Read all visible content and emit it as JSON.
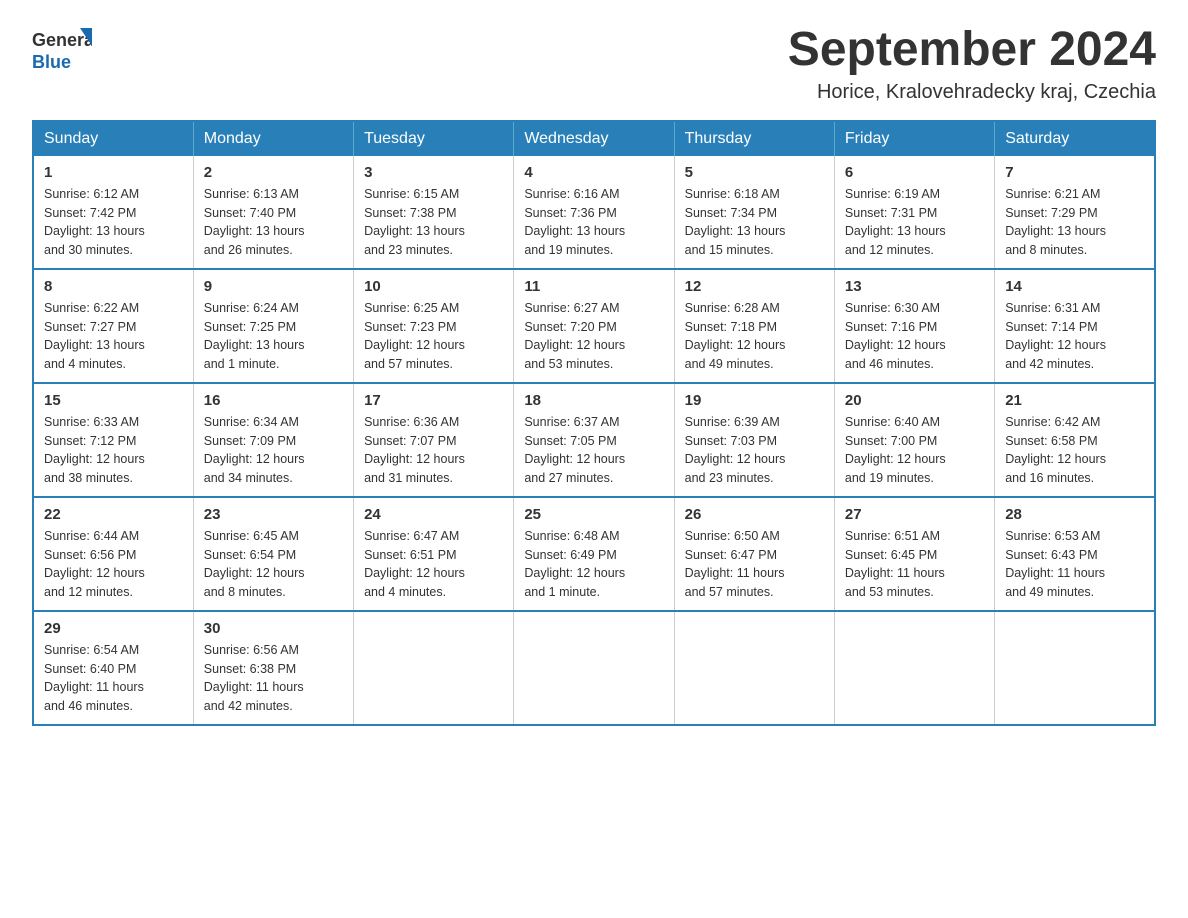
{
  "header": {
    "logo_general": "General",
    "logo_blue": "Blue",
    "month_title": "September 2024",
    "location": "Horice, Kralovehradecky kraj, Czechia"
  },
  "weekdays": [
    "Sunday",
    "Monday",
    "Tuesday",
    "Wednesday",
    "Thursday",
    "Friday",
    "Saturday"
  ],
  "weeks": [
    [
      {
        "day": "1",
        "sunrise": "6:12 AM",
        "sunset": "7:42 PM",
        "daylight": "13 hours and 30 minutes."
      },
      {
        "day": "2",
        "sunrise": "6:13 AM",
        "sunset": "7:40 PM",
        "daylight": "13 hours and 26 minutes."
      },
      {
        "day": "3",
        "sunrise": "6:15 AM",
        "sunset": "7:38 PM",
        "daylight": "13 hours and 23 minutes."
      },
      {
        "day": "4",
        "sunrise": "6:16 AM",
        "sunset": "7:36 PM",
        "daylight": "13 hours and 19 minutes."
      },
      {
        "day": "5",
        "sunrise": "6:18 AM",
        "sunset": "7:34 PM",
        "daylight": "13 hours and 15 minutes."
      },
      {
        "day": "6",
        "sunrise": "6:19 AM",
        "sunset": "7:31 PM",
        "daylight": "13 hours and 12 minutes."
      },
      {
        "day": "7",
        "sunrise": "6:21 AM",
        "sunset": "7:29 PM",
        "daylight": "13 hours and 8 minutes."
      }
    ],
    [
      {
        "day": "8",
        "sunrise": "6:22 AM",
        "sunset": "7:27 PM",
        "daylight": "13 hours and 4 minutes."
      },
      {
        "day": "9",
        "sunrise": "6:24 AM",
        "sunset": "7:25 PM",
        "daylight": "13 hours and 1 minute."
      },
      {
        "day": "10",
        "sunrise": "6:25 AM",
        "sunset": "7:23 PM",
        "daylight": "12 hours and 57 minutes."
      },
      {
        "day": "11",
        "sunrise": "6:27 AM",
        "sunset": "7:20 PM",
        "daylight": "12 hours and 53 minutes."
      },
      {
        "day": "12",
        "sunrise": "6:28 AM",
        "sunset": "7:18 PM",
        "daylight": "12 hours and 49 minutes."
      },
      {
        "day": "13",
        "sunrise": "6:30 AM",
        "sunset": "7:16 PM",
        "daylight": "12 hours and 46 minutes."
      },
      {
        "day": "14",
        "sunrise": "6:31 AM",
        "sunset": "7:14 PM",
        "daylight": "12 hours and 42 minutes."
      }
    ],
    [
      {
        "day": "15",
        "sunrise": "6:33 AM",
        "sunset": "7:12 PM",
        "daylight": "12 hours and 38 minutes."
      },
      {
        "day": "16",
        "sunrise": "6:34 AM",
        "sunset": "7:09 PM",
        "daylight": "12 hours and 34 minutes."
      },
      {
        "day": "17",
        "sunrise": "6:36 AM",
        "sunset": "7:07 PM",
        "daylight": "12 hours and 31 minutes."
      },
      {
        "day": "18",
        "sunrise": "6:37 AM",
        "sunset": "7:05 PM",
        "daylight": "12 hours and 27 minutes."
      },
      {
        "day": "19",
        "sunrise": "6:39 AM",
        "sunset": "7:03 PM",
        "daylight": "12 hours and 23 minutes."
      },
      {
        "day": "20",
        "sunrise": "6:40 AM",
        "sunset": "7:00 PM",
        "daylight": "12 hours and 19 minutes."
      },
      {
        "day": "21",
        "sunrise": "6:42 AM",
        "sunset": "6:58 PM",
        "daylight": "12 hours and 16 minutes."
      }
    ],
    [
      {
        "day": "22",
        "sunrise": "6:44 AM",
        "sunset": "6:56 PM",
        "daylight": "12 hours and 12 minutes."
      },
      {
        "day": "23",
        "sunrise": "6:45 AM",
        "sunset": "6:54 PM",
        "daylight": "12 hours and 8 minutes."
      },
      {
        "day": "24",
        "sunrise": "6:47 AM",
        "sunset": "6:51 PM",
        "daylight": "12 hours and 4 minutes."
      },
      {
        "day": "25",
        "sunrise": "6:48 AM",
        "sunset": "6:49 PM",
        "daylight": "12 hours and 1 minute."
      },
      {
        "day": "26",
        "sunrise": "6:50 AM",
        "sunset": "6:47 PM",
        "daylight": "11 hours and 57 minutes."
      },
      {
        "day": "27",
        "sunrise": "6:51 AM",
        "sunset": "6:45 PM",
        "daylight": "11 hours and 53 minutes."
      },
      {
        "day": "28",
        "sunrise": "6:53 AM",
        "sunset": "6:43 PM",
        "daylight": "11 hours and 49 minutes."
      }
    ],
    [
      {
        "day": "29",
        "sunrise": "6:54 AM",
        "sunset": "6:40 PM",
        "daylight": "11 hours and 46 minutes."
      },
      {
        "day": "30",
        "sunrise": "6:56 AM",
        "sunset": "6:38 PM",
        "daylight": "11 hours and 42 minutes."
      },
      null,
      null,
      null,
      null,
      null
    ]
  ],
  "labels": {
    "sunrise": "Sunrise:",
    "sunset": "Sunset:",
    "daylight": "Daylight:"
  }
}
